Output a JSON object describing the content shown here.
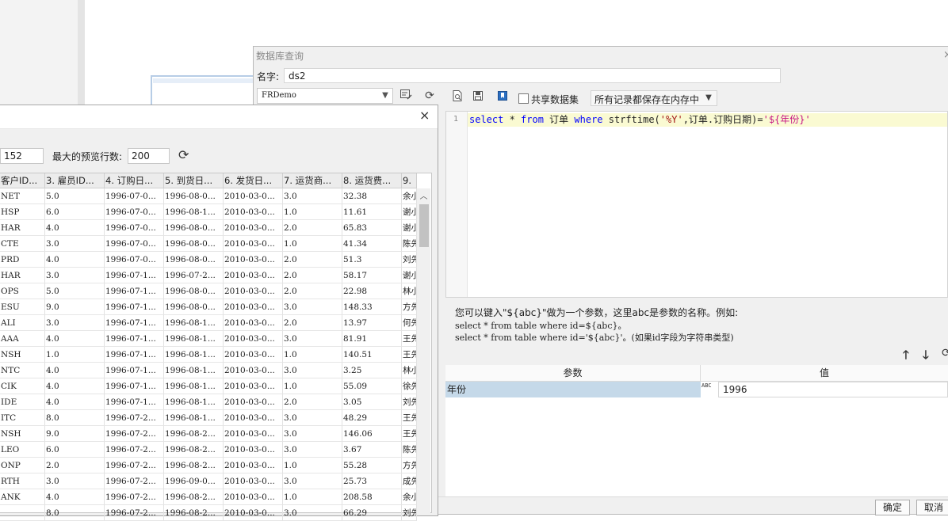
{
  "query_dialog": {
    "title": "数据库查询",
    "close_glyph": "×",
    "name_label": "名字:",
    "name_value": "ds2",
    "connection": "FRDemo",
    "share_label": "共享数据集",
    "cache_mode": "所有记录都保存在内存中",
    "sql": {
      "line_number": "1",
      "p1": "select",
      "p2": " * ",
      "p3": "from",
      "p4": " 订单 ",
      "p5": "where",
      "p6": " strftime(",
      "p7": "'%Y'",
      "p8": ",订单.订购日期)=",
      "p9": "'${年份}'"
    },
    "hint_line1": "您可以键入\"${abc}\"做为一个参数，这里abc是参数的名称。例如:",
    "hint_line2": "select * from table where id=${abc}。",
    "hint_line3": "select * from table where id='${abc}'。(如果id字段为字符串类型)",
    "params_header": {
      "param": "参数",
      "value": "值"
    },
    "param_row": {
      "name": "年份",
      "type_icon": "ABC",
      "value": "1996"
    },
    "ok_label": "确定",
    "cancel_label": "取消"
  },
  "preview_dialog": {
    "close_glyph": "×",
    "total_rows": "152",
    "max_rows_label": "最大的预览行数:",
    "max_rows_value": "200",
    "headers": [
      "客户ID...",
      "3. 雇员ID...",
      "4. 订购日...",
      "5. 到货日...",
      "6. 发货日...",
      "7. 运货商...",
      "8. 运货费...",
      "9."
    ],
    "rows": [
      [
        "NET",
        "5.0",
        "1996-07-0...",
        "1996-08-0...",
        "2010-03-0...",
        "3.0",
        "32.38",
        "余小"
      ],
      [
        "HSP",
        "6.0",
        "1996-07-0...",
        "1996-08-1...",
        "2010-03-0...",
        "1.0",
        "11.61",
        "谢小"
      ],
      [
        "HAR",
        "4.0",
        "1996-07-0...",
        "1996-08-0...",
        "2010-03-0...",
        "2.0",
        "65.83",
        "谢小"
      ],
      [
        "CTE",
        "3.0",
        "1996-07-0...",
        "1996-08-0...",
        "2010-03-0...",
        "1.0",
        "41.34",
        "陈先"
      ],
      [
        "PRD",
        "4.0",
        "1996-07-0...",
        "1996-08-0...",
        "2010-03-0...",
        "2.0",
        "51.3",
        "刘先"
      ],
      [
        "HAR",
        "3.0",
        "1996-07-1...",
        "1996-07-2...",
        "2010-03-0...",
        "2.0",
        "58.17",
        "谢小"
      ],
      [
        "OPS",
        "5.0",
        "1996-07-1...",
        "1996-08-0...",
        "2010-03-0...",
        "2.0",
        "22.98",
        "林小"
      ],
      [
        "ESU",
        "9.0",
        "1996-07-1...",
        "1996-08-0...",
        "2010-03-0...",
        "3.0",
        "148.33",
        "方先"
      ],
      [
        "ALI",
        "3.0",
        "1996-07-1...",
        "1996-08-1...",
        "2010-03-0...",
        "2.0",
        "13.97",
        "何先"
      ],
      [
        "AAA",
        "4.0",
        "1996-07-1...",
        "1996-08-1...",
        "2010-03-0...",
        "3.0",
        "81.91",
        "王先"
      ],
      [
        "NSH",
        "1.0",
        "1996-07-1...",
        "1996-08-1...",
        "2010-03-0...",
        "1.0",
        "140.51",
        "王先"
      ],
      [
        "NTC",
        "4.0",
        "1996-07-1...",
        "1996-08-1...",
        "2010-03-0...",
        "3.0",
        "3.25",
        "林小"
      ],
      [
        "CIK",
        "4.0",
        "1996-07-1...",
        "1996-08-1...",
        "2010-03-0...",
        "1.0",
        "55.09",
        "徐先"
      ],
      [
        "IDE",
        "4.0",
        "1996-07-1...",
        "1996-08-1...",
        "2010-03-0...",
        "2.0",
        "3.05",
        "刘先"
      ],
      [
        "ITC",
        "8.0",
        "1996-07-2...",
        "1996-08-1...",
        "2010-03-0...",
        "3.0",
        "48.29",
        "王先"
      ],
      [
        "NSH",
        "9.0",
        "1996-07-2...",
        "1996-08-2...",
        "2010-03-0...",
        "3.0",
        "146.06",
        "王先"
      ],
      [
        "LEO",
        "6.0",
        "1996-07-2...",
        "1996-08-2...",
        "2010-03-0...",
        "3.0",
        "3.67",
        "陈先"
      ],
      [
        "ONP",
        "2.0",
        "1996-07-2...",
        "1996-08-2...",
        "2010-03-0...",
        "1.0",
        "55.28",
        "方先"
      ],
      [
        "RTH",
        "3.0",
        "1996-07-2...",
        "1996-09-0...",
        "2010-03-0...",
        "3.0",
        "25.73",
        "成先"
      ],
      [
        "ANK",
        "4.0",
        "1996-07-2...",
        "1996-08-2...",
        "2010-03-0...",
        "1.0",
        "208.58",
        "余小"
      ],
      [
        "",
        "8.0",
        "1996-07-2...",
        "1996-08-2...",
        "2010-03-0...",
        "3.0",
        "66.29",
        "刘先"
      ]
    ]
  }
}
